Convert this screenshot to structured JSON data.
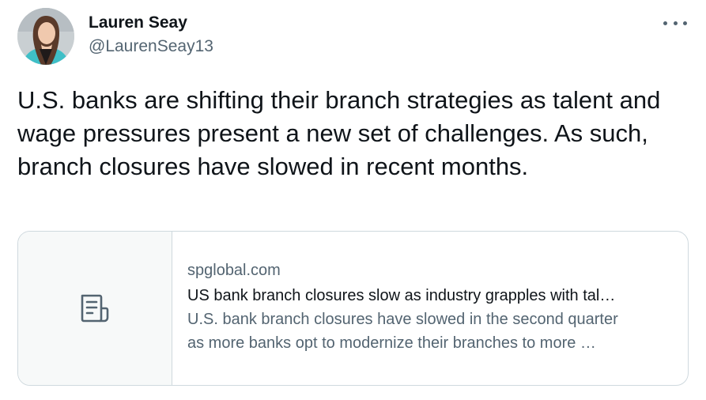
{
  "author": {
    "name": "Lauren Seay",
    "handle": "@LaurenSeay13"
  },
  "tweet": {
    "text": "U.S. banks are shifting their branch strategies as talent and wage pressures present a new set of challenges. As such, branch closures have slowed in recent months."
  },
  "link_card": {
    "domain": "spglobal.com",
    "title": "US bank branch closures slow as industry grapples with tal…",
    "description_line1": "U.S. bank branch closures have slowed in the second quarter",
    "description_line2": "as more banks opt to modernize their branches to more …",
    "thumbnail_icon": "article-icon"
  },
  "more_menu": {
    "icon": "more-icon"
  },
  "colors": {
    "text_primary": "#0f1419",
    "text_secondary": "#536471",
    "border": "#cfd9de",
    "thumb_bg": "#f7f9f9"
  }
}
